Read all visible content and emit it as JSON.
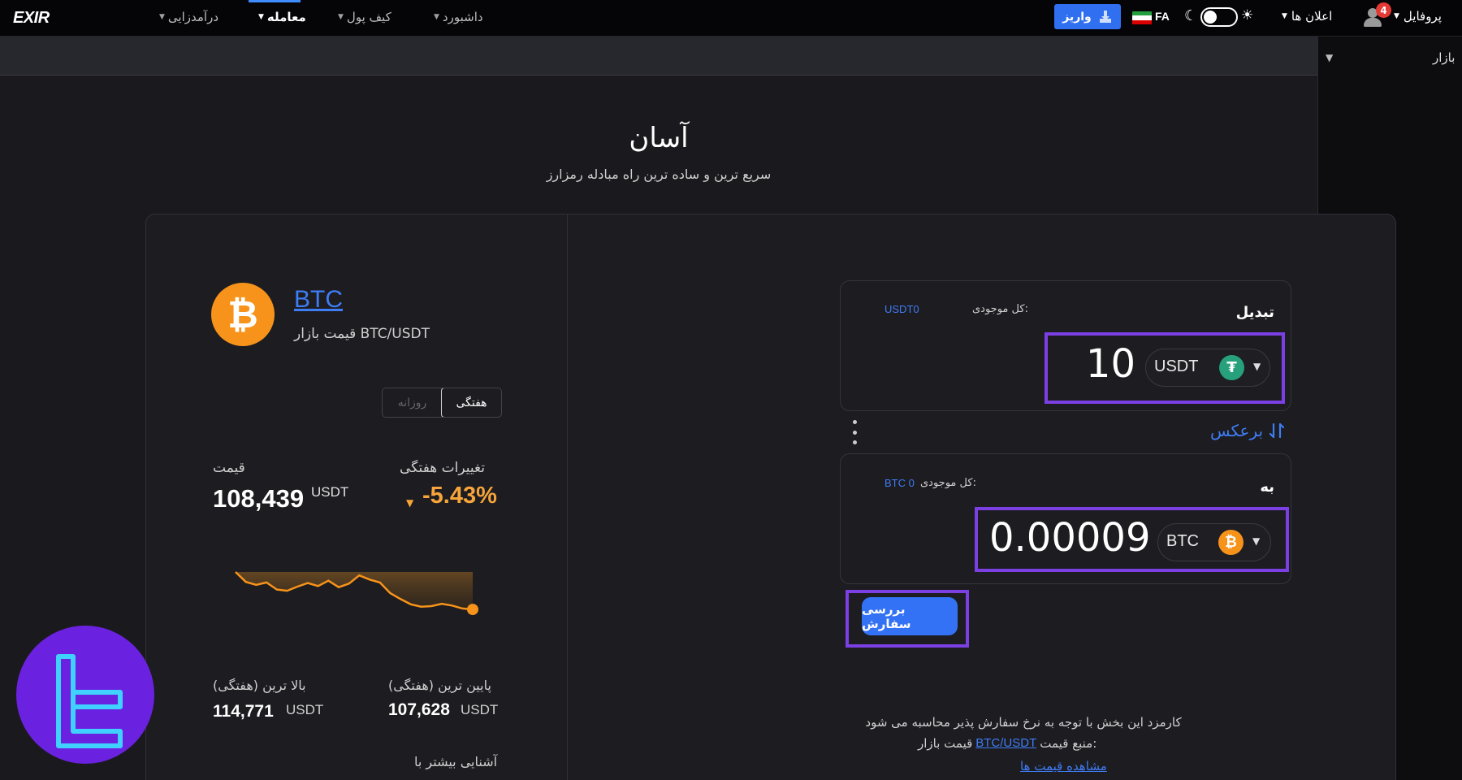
{
  "brand": {
    "logo_text": "EXIR"
  },
  "nav": {
    "items": [
      {
        "label": "پروفایل"
      },
      {
        "label": "اعلان ها"
      },
      {
        "label": "داشبورد"
      },
      {
        "label": "کیف پول"
      },
      {
        "label": "معامله"
      },
      {
        "label": "درآمدزایی"
      }
    ],
    "deposit_label": "واریز",
    "lang_label": "FA",
    "notification_count": "4",
    "theme_mode": "dark"
  },
  "subbar": {
    "market_label": "بازار"
  },
  "header": {
    "title": "آسان",
    "subtitle": "سریع ترین و ساده ترین راه مبادله رمزارز"
  },
  "coin_info": {
    "symbol": "BTC",
    "market_price_label": "قیمت بازار BTC/USDT",
    "tabs": [
      {
        "label": "هفتگی",
        "active": true
      },
      {
        "label": "روزانه",
        "active": false
      }
    ],
    "price_label": "قیمت",
    "price_value": "108,439",
    "price_unit": "USDT",
    "weekly_change_label": "تغییرات هفتگی",
    "weekly_change_value": "-5.43%",
    "low_label": "پایین ترین (هفتگی)",
    "low_value": "107,628",
    "low_unit": "USDT",
    "high_label": "بالا ترین (هفتگی)",
    "high_value": "114,771",
    "high_unit": "USDT",
    "learn_more": "آشنایی بیشتر با"
  },
  "chart_data": {
    "type": "line",
    "series": [
      {
        "values": [
          114771,
          113100,
          112600,
          113000,
          111800,
          111600,
          112300,
          112900,
          112400,
          113300,
          112200,
          112800,
          114200,
          113500,
          113000,
          111200,
          110200,
          109300,
          108900,
          109000,
          109400,
          109100,
          108600,
          108439
        ]
      }
    ],
    "ylim": [
      107628,
      114771
    ],
    "color": "#f7931a"
  },
  "exchange": {
    "from": {
      "title": "تبدیل",
      "balance_label": "کل موجودی:",
      "balance_value": "USDT0",
      "amount": "10",
      "coin": "USDT",
      "coin_icon": "tether-icon"
    },
    "reverse_label": "برعکس",
    "to": {
      "title": "به",
      "balance_label": "کل موجودی:",
      "balance_value": "BTC 0",
      "amount": "0.00009",
      "coin": "BTC",
      "coin_icon": "bitcoin-icon"
    },
    "review_button": "بررسی سفارش",
    "fee_note": "کارمزد این بخش با توجه به نرخ سفارش پذیر محاسبه می شود",
    "price_source_label": "منبع قیمت:",
    "price_source_link": "BTC/USDT",
    "price_source_suffix": "قیمت بازار",
    "see_prices_link": "مشاهده قیمت ها"
  },
  "colors": {
    "accent": "#3f7df5",
    "highlight": "#7b3fe4",
    "btc": "#f7931a",
    "tether": "#26a17b",
    "negative": "#f7a53a"
  }
}
